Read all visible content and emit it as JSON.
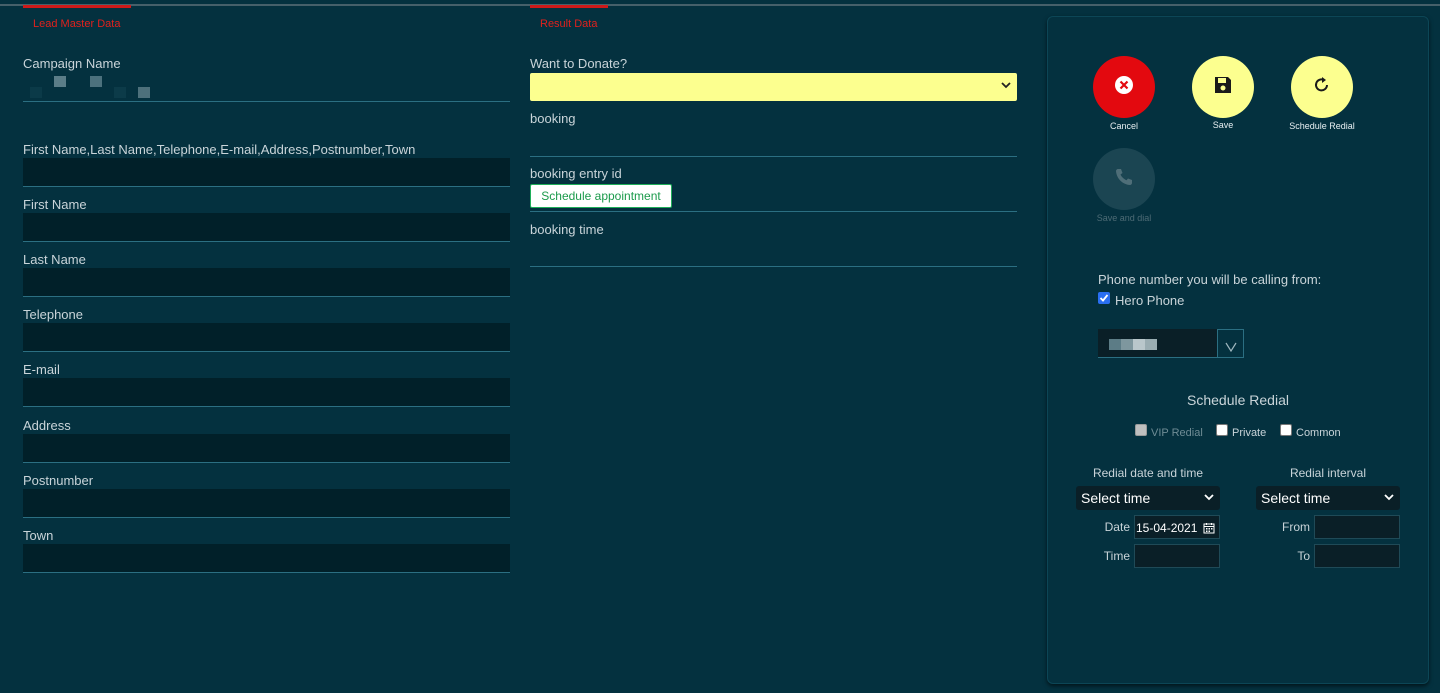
{
  "tabs": {
    "lead_master": "Lead Master Data",
    "result": "Result Data"
  },
  "lead": {
    "campaign_label": "Campaign Name",
    "combined_label": "First Name,Last Name,Telephone,E-mail,Address,Postnumber,Town",
    "first_name_label": "First Name",
    "last_name_label": "Last Name",
    "telephone_label": "Telephone",
    "email_label": "E-mail",
    "address_label": "Address",
    "postnumber_label": "Postnumber",
    "town_label": "Town"
  },
  "result": {
    "donate_label": "Want to Donate?",
    "booking_label": "booking",
    "booking_entry_label": "booking entry id",
    "schedule_appointment": "Schedule appointment",
    "booking_time_label": "booking time"
  },
  "actions": {
    "cancel": "Cancel",
    "save": "Save",
    "schedule_redial": "Schedule Redial",
    "save_and_dial": "Save and dial"
  },
  "phone": {
    "calling_from_label": "Phone number you will be calling from:",
    "hero_phone_label": "Hero Phone",
    "hero_phone_checked": true
  },
  "redial": {
    "title": "Schedule Redial",
    "vip_label": "VIP Redial",
    "private_label": "Private",
    "common_label": "Common",
    "date_time_label": "Redial date and time",
    "interval_label": "Redial interval",
    "select_time_1": "Select time",
    "select_time_2": "Select time",
    "date_label": "Date",
    "date_value": "15-04-2021",
    "time_label": "Time",
    "from_label": "From",
    "to_label": "To"
  },
  "colors": {
    "background": "#04313f",
    "cancel_red": "#e3090f",
    "action_yellow": "#fcff8f",
    "donate_select": "#fcff8f",
    "tab_red": "#e0211d"
  }
}
